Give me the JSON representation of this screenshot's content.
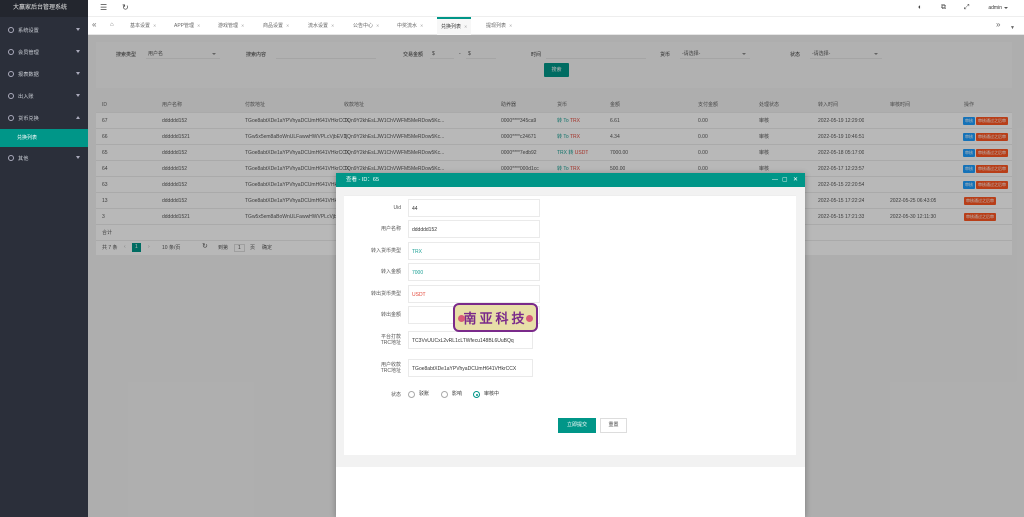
{
  "app": {
    "title": "大赢家后台管理系统"
  },
  "sidebar": {
    "items": [
      {
        "label": "系统设置",
        "icon": "gear-icon"
      },
      {
        "label": "会员管理",
        "icon": "user-icon"
      },
      {
        "label": "报表数据",
        "icon": "eye-icon"
      },
      {
        "label": "出入账",
        "icon": "exchange-icon"
      },
      {
        "label": "货币兑换",
        "icon": "coin-icon"
      },
      {
        "label": "其他",
        "icon": "plus-icon"
      }
    ],
    "active_sub": "兑换列表"
  },
  "topbar": {
    "user": "admin"
  },
  "tabs": [
    "基本设置",
    "APP管理",
    "游戏管理",
    "商品设置",
    "流水设置",
    "公告中心",
    "中奖流水",
    "兑换列表",
    "提现列表"
  ],
  "filter": {
    "search_type_label": "搜索类型",
    "search_type_value": "用户名",
    "search_content_label": "搜索内容",
    "amount_label": "交易金额",
    "amount_unit": "$",
    "amount_sep": "-",
    "time_label": "时间",
    "currency_label": "货币",
    "currency_value": "-请选择-",
    "status_label": "状态",
    "status_value": "-请选择-",
    "search_button": "搜索"
  },
  "table": {
    "columns": [
      "ID",
      "用户名称",
      "付款地址",
      "收款地址",
      "助养器",
      "货币",
      "金额",
      "支付金额",
      "处理状态",
      "转入时间",
      "审核时间",
      "操作"
    ],
    "rows": [
      {
        "id": "67",
        "user": "dddddd152",
        "pay": "TGoe8abtXDe1aYPVhyaDCUmH641VHkrCCX",
        "recv": "TQn9Y2khEsLJW1ChVWFM5MeRDow5Kc...",
        "helper": "0000****345ca9",
        "from": "转",
        "mid": "To",
        "to": "TRX",
        "amt": "6.61",
        "paid": "0.00",
        "status": "审核",
        "time": "2022-05-19 12:29:00",
        "audit": "",
        "ops": [
          "审核",
          "审核通过之后审"
        ]
      },
      {
        "id": "66",
        "user": "dddddd1521",
        "pay": "TGw5x5em8aBoWnULFawwHWVPLcVjbEV1j",
        "recv": "TQn9Y2khEsLJW1ChVWFM5MeRDow5Kc...",
        "helper": "0000****c24671",
        "from": "转",
        "mid": "To",
        "to": "TRX",
        "amt": "4.34",
        "paid": "0.00",
        "status": "审核",
        "time": "2022-05-19 10:46:51",
        "audit": "",
        "ops": [
          "审核",
          "审核通过之后审"
        ]
      },
      {
        "id": "65",
        "user": "dddddd152",
        "pay": "TGoe8abtXDe1aYPVhyaDCUmH641VHkrCCX",
        "recv": "TQn9Y2khEsLJW1ChVWFM5MeRDow5Kc...",
        "helper": "0000****7edb92",
        "from": "TRX",
        "mid": "转",
        "to": "USDT",
        "amt": "7000.00",
        "paid": "0.00",
        "status": "审核",
        "time": "2022-05-18 05:17:00",
        "audit": "",
        "ops": [
          "审核",
          "审核通过之后审"
        ]
      },
      {
        "id": "64",
        "user": "dddddd152",
        "pay": "TGoe8abtXDe1aYPVhyaDCUmH641VHkrCCX",
        "recv": "TQn9Y2khEsLJW1ChVWFM5MeRDow5Kc...",
        "helper": "0000****000d1cc",
        "from": "转",
        "mid": "To",
        "to": "TRX",
        "amt": "500.00",
        "paid": "0.00",
        "status": "审核",
        "time": "2022-05-17 12:23:57",
        "audit": "",
        "ops": [
          "审核",
          "审核通过之后审"
        ]
      },
      {
        "id": "63",
        "user": "dddddd152",
        "pay": "TGoe8abtXDe1aYPVhyaDCUmH641VHkrCCX",
        "recv": "",
        "helper": "",
        "from": "",
        "mid": "",
        "to": "",
        "amt": "",
        "paid": "",
        "status": "",
        "time": "2022-05-15 22:20:54",
        "audit": "",
        "ops": [
          "审核",
          "审核通过之后审"
        ]
      },
      {
        "id": "13",
        "user": "dddddd152",
        "pay": "TGoe8abtXDe1aYPVhyaDCUmH641VHkrCCX",
        "recv": "",
        "helper": "",
        "from": "",
        "mid": "",
        "to": "",
        "amt": "",
        "paid": "",
        "status": "",
        "time": "2022-05-15 17:22:24",
        "audit": "2022-05-25 06:43:05",
        "ops": [
          "审核通过之后审"
        ]
      },
      {
        "id": "3",
        "user": "dddddd1521",
        "pay": "TGw5x5em8aBoWnULFawwHWVPLcVjbEV1j",
        "recv": "",
        "helper": "",
        "from": "",
        "mid": "",
        "to": "",
        "amt": "",
        "paid": "",
        "status": "",
        "time": "2022-05-15 17:21:33",
        "audit": "2022-05-30 12:11:30",
        "ops": [
          "审核通过之后审"
        ]
      }
    ],
    "total_label": "合计"
  },
  "pager": {
    "total": "共 7 条",
    "page": "1",
    "per_page": "10 条/页",
    "goto": "到第",
    "goto_val": "1",
    "unit": "页",
    "confirm": "确定"
  },
  "modal": {
    "title": "查看 - ID：65",
    "fields": [
      {
        "label": "Uid",
        "value": "44"
      },
      {
        "label": "用户名称",
        "value": "dddddd152"
      },
      {
        "label": "转入货币类型",
        "value": "TRX"
      },
      {
        "label": "转入金额",
        "value": "7000"
      },
      {
        "label": "转出货币类型",
        "value": "USDT"
      },
      {
        "label": "转出金额",
        "value": ""
      },
      {
        "label": "平台打款TRC地址",
        "value": "TC3VvUUCxL2vRL1cLTWfecu148BL6UuBQq"
      },
      {
        "label": "用户收款TRC地址",
        "value": "TGoe8abtXDe1aYPVhyaDCUmH641VHkrCCX"
      }
    ],
    "status_label": "状态",
    "status_options": [
      "驳账",
      "影响",
      "审核中"
    ],
    "status_selected": 2,
    "submit": "立即提交",
    "reset": "重置"
  },
  "watermark": {
    "text": "南亚科技"
  }
}
